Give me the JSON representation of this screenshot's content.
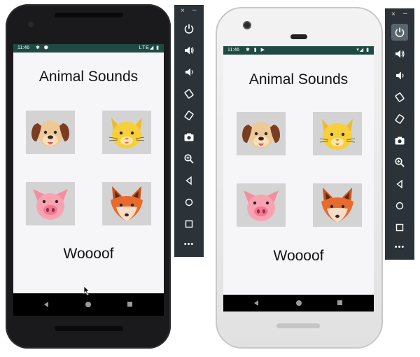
{
  "app": {
    "title": "Animal Sounds",
    "current_sound_text": "Woooof",
    "tiles": [
      {
        "name": "dog",
        "icon": "dog-face-icon"
      },
      {
        "name": "cat",
        "icon": "cat-face-icon"
      },
      {
        "name": "pig",
        "icon": "pig-face-icon"
      },
      {
        "name": "fox",
        "icon": "fox-face-icon"
      }
    ]
  },
  "devices": [
    {
      "status_time": "11:46",
      "status_icons_left": "✱ ⬢",
      "status_icons_right": "LTE◢ ▮"
    },
    {
      "status_time": "11:46",
      "status_icons_left": "✱ ▮ ▶",
      "status_icons_right": "▾◢ ▮"
    }
  ],
  "toolbar": {
    "close_label": "×",
    "minimize_label": "–",
    "more_label": "•••",
    "buttons": [
      "power-icon",
      "volume-up-icon",
      "volume-down-icon",
      "rotate-left-icon",
      "rotate-right-icon",
      "camera-icon",
      "zoom-icon",
      "back-icon",
      "home-icon",
      "overview-icon"
    ]
  },
  "colors": {
    "status_bar": "#1f4a43",
    "toolbar_bg": "#2b3338",
    "tile_bg": "#d3d3d3",
    "screen_bg": "#f6f6f8"
  }
}
